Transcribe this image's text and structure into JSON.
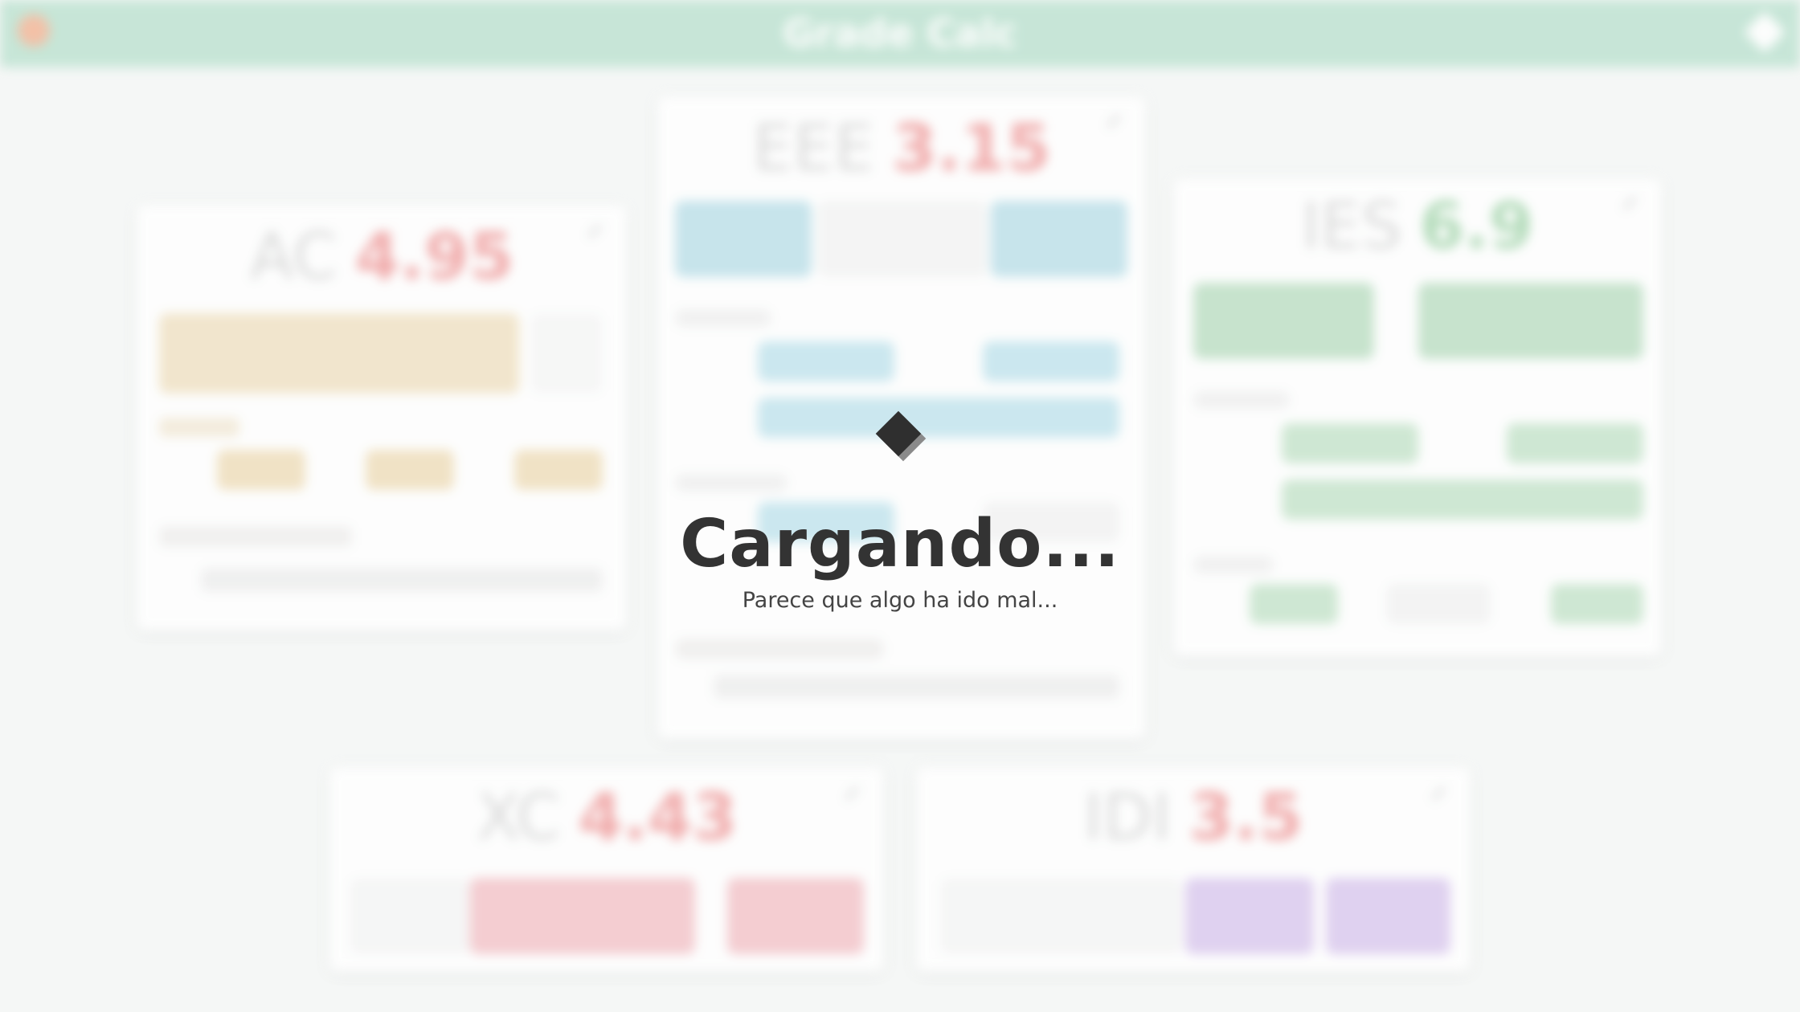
{
  "app": {
    "title": "Grade Calc"
  },
  "cards": [
    {
      "name": "AC",
      "grade": "4.95"
    },
    {
      "name": "EEE",
      "grade": "3.15"
    },
    {
      "name": "IES",
      "grade": "6.9"
    },
    {
      "name": "XC",
      "grade": "4.43"
    },
    {
      "name": "IDI",
      "grade": "3.5"
    }
  ],
  "loading": {
    "title": "Cargando...",
    "subtitle": "Parece que algo ha ido mal..."
  }
}
